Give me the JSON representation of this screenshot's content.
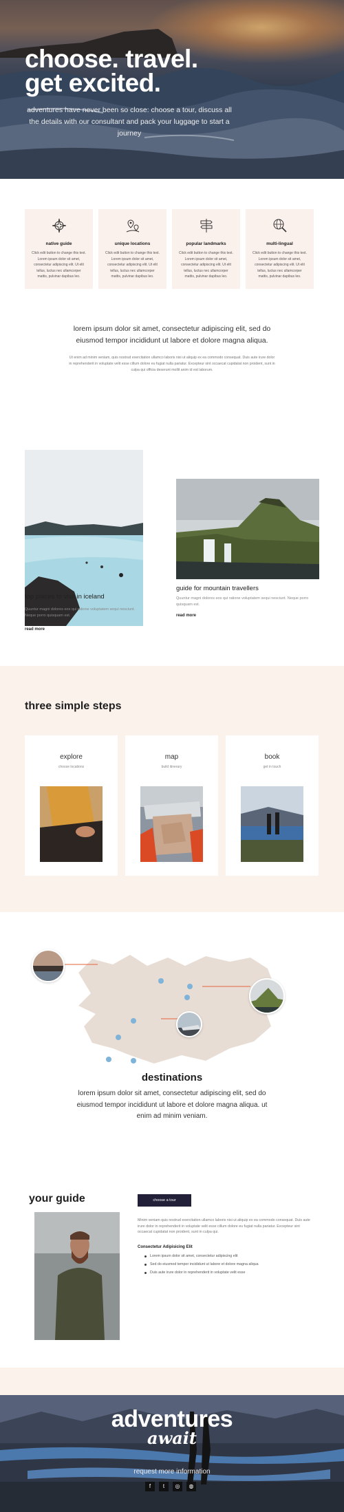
{
  "hero": {
    "title_line1": "choose. travel.",
    "title_line2": "get excited.",
    "subtitle": "adventures have never been so close: choose a tour, discuss all the details with our consultant and pack your luggage to start a journey"
  },
  "features": [
    {
      "icon": "compass-icon",
      "title": "native guide",
      "text": "Click edit button to change this text. Lorem ipsum dolor sit amet, consectetur adipiscing elit. Ut elit tellus, luctus nec ullamcorper mattis, pulvinar dapibus leo."
    },
    {
      "icon": "location-pins-icon",
      "title": "unique locations",
      "text": "Click edit button to change this text. Lorem ipsum dolor sit amet, consectetur adipiscing elit. Ut elit tellus, luctus nec ullamcorper mattis, pulvinar dapibus leo."
    },
    {
      "icon": "signpost-icon",
      "title": "popular landmarks",
      "text": "Click edit button to change this text. Lorem ipsum dolor sit amet, consectetur adipiscing elit. Ut elit tellus, luctus nec ullamcorper mattis, pulvinar dapibus leo."
    },
    {
      "icon": "globe-search-icon",
      "title": "multi-lingual",
      "text": "Click edit button to change this text. Lorem ipsum dolor sit amet, consectetur adipiscing elit. Ut elit tellus, luctus nec ullamcorper mattis, pulvinar dapibus leo."
    }
  ],
  "intro": {
    "lead": "lorem ipsum dolor sit amet, consectetur adipiscing elit, sed do eiusmod tempor incididunt ut labore et dolore magna aliqua.",
    "body": "Ut enim ad minim veniam, quis nostrud exercitation ullamco laboris nisi ut aliquip ex ea commodo consequat. Duis aute irure dolor in reprehenderit in voluptate velit esse cillum dolore eu fugiat nulla pariatur. Excepteur sint occaecat cupidatat non proident, sunt in culpa qui officia deserunt mollit anim id est laborum."
  },
  "articles": [
    {
      "title": "top places to visit in iceland",
      "text": "Quuntur magni dolores eos qui ratione voluptatem sequi nesciunt. Neque porro quisquam est.",
      "link": "read more"
    },
    {
      "title": "guide for mountain travellers",
      "text": "Quuntur magni dolores eos qui ratione voluptatem sequi nesciunt. Neque porro quisquam est.",
      "link": "read more"
    }
  ],
  "steps": {
    "heading": "three simple steps",
    "items": [
      {
        "title": "explore",
        "subtitle": "choose locations"
      },
      {
        "title": "map",
        "subtitle": "build itinerary"
      },
      {
        "title": "book",
        "subtitle": "get in touch"
      }
    ]
  },
  "destinations": {
    "heading": "destinations",
    "text": "lorem ipsum dolor sit amet, consectetur adipiscing elit, sed do eiusmod tempor incididunt ut labore et dolore magna aliqua. ut enim ad minim veniam."
  },
  "guide": {
    "heading": "your guide",
    "button": "choose a tour",
    "text": "Minim veniam quis nostrud exercitation ullamco laboris nisi ut aliquip ex ea commodo consequat. Duis aute irure dolor in reprehenderit in voluptate velit esse cillum dolore eu fugiat nulla pariatur. Excepteur sint occaecat cupidatat non proident, sunt in culpa qui.",
    "subheading": "Consectetur Adipisicing Elit",
    "bullets": [
      "Lorem ipsum dolor sit amet, consectetur adipiscing elit",
      "Sed do eiusmod tempor incididunt ut labore et dolore magna aliqua",
      "Duis aute irure dolor in reprehenderit in voluptate velit esse"
    ]
  },
  "adventures": {
    "title": "adventures",
    "script": "await",
    "link": "request more information",
    "social": [
      {
        "icon": "facebook-icon",
        "glyph": "f"
      },
      {
        "icon": "twitter-icon",
        "glyph": "t"
      },
      {
        "icon": "instagram-icon",
        "glyph": "◎"
      },
      {
        "icon": "globe-icon",
        "glyph": "◍"
      }
    ]
  },
  "colors": {
    "accent_peach": "#fcf2ec",
    "button_navy": "#221f38",
    "map_tan": "#e8ddd4",
    "map_pin": "#7fb3d8",
    "connector": "#e2633a"
  }
}
